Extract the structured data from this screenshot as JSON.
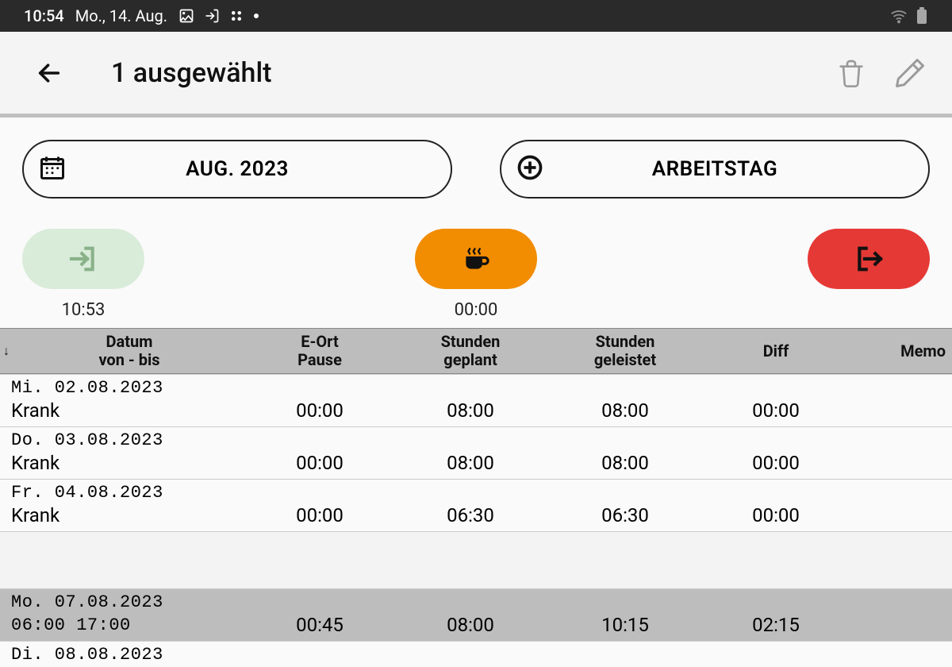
{
  "status": {
    "time": "10:54",
    "date": "Mo., 14. Aug."
  },
  "appbar": {
    "title": "1 ausgewählt"
  },
  "pills": {
    "month": "AUG. 2023",
    "workday": "ARBEITSTAG"
  },
  "actions": {
    "checkin_time": "10:53",
    "break_time": "00:00"
  },
  "table": {
    "headers": {
      "date_line1": "Datum",
      "date_line2": "von - bis",
      "eort_line1": "E-Ort",
      "eort_line2": "Pause",
      "plan_line1": "Stunden",
      "plan_line2": "geplant",
      "done_line1": "Stunden",
      "done_line2": "geleistet",
      "diff": "Diff",
      "memo": "Memo",
      "sort": "↓"
    },
    "rows": [
      {
        "date": "Mi. 02.08.2023",
        "from_to": "Krank",
        "eort": "00:00",
        "plan": "08:00",
        "done": "08:00",
        "diff": "00:00",
        "selected": false,
        "mono": false
      },
      {
        "date": "Do. 03.08.2023",
        "from_to": "Krank",
        "eort": "00:00",
        "plan": "08:00",
        "done": "08:00",
        "diff": "00:00",
        "selected": false,
        "mono": false
      },
      {
        "date": "Fr. 04.08.2023",
        "from_to": "Krank",
        "eort": "00:00",
        "plan": "06:30",
        "done": "06:30",
        "diff": "00:00",
        "selected": false,
        "mono": false
      },
      {
        "gap": true
      },
      {
        "date": "Mo. 07.08.2023",
        "from_to": "06:00  17:00",
        "eort": "00:45",
        "plan": "08:00",
        "done": "10:15",
        "diff": "02:15",
        "selected": true,
        "mono": true
      },
      {
        "date": "Di. 08.08.2023",
        "from_to": "",
        "eort": "",
        "plan": "",
        "done": "",
        "diff": "",
        "selected": false,
        "partial": true
      }
    ]
  }
}
